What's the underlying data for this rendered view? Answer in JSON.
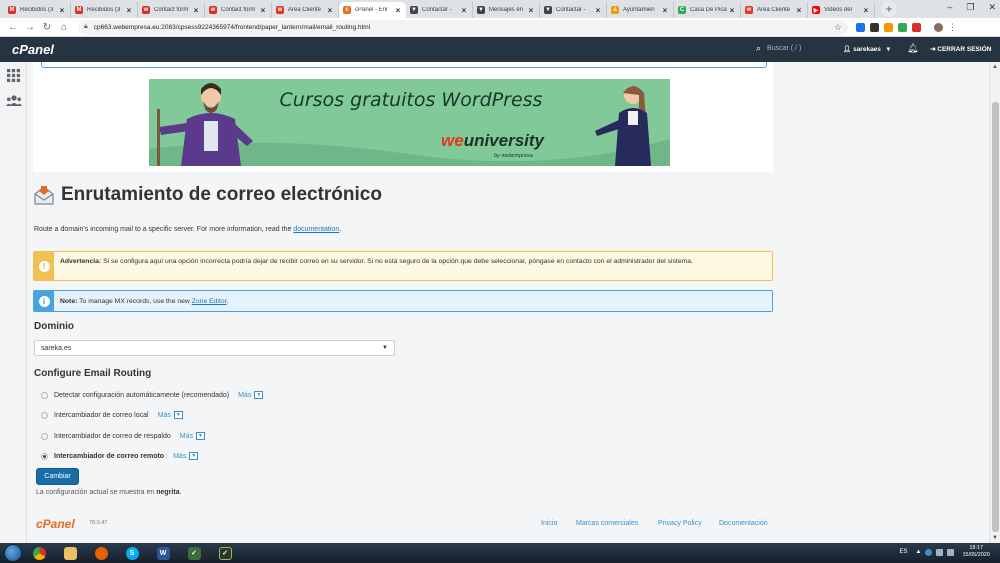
{
  "browser": {
    "tabs": [
      {
        "label": "Recibidos (3",
        "icon": "gmail-icon",
        "color": "#d93025",
        "glyph": "M"
      },
      {
        "label": "Recibidos (3",
        "icon": "gmail-icon",
        "color": "#d93025",
        "glyph": "M"
      },
      {
        "label": "Contact form",
        "icon": "site-icon",
        "color": "#d93025",
        "glyph": "w"
      },
      {
        "label": "Contact form",
        "icon": "site-icon",
        "color": "#d93025",
        "glyph": "w"
      },
      {
        "label": "Área Cliente",
        "icon": "webempresa-icon",
        "color": "#e2371f",
        "glyph": "w"
      },
      {
        "label": "cPanel - Enr",
        "icon": "cpanel-icon",
        "color": "#e46d24",
        "glyph": "c",
        "active": true
      },
      {
        "label": "Contactar -",
        "icon": "site-icon",
        "color": "#444444",
        "glyph": "▼"
      },
      {
        "label": "Mensajes en",
        "icon": "site-icon",
        "color": "#444444",
        "glyph": "▼"
      },
      {
        "label": "Contactar -",
        "icon": "site-icon",
        "color": "#444444",
        "glyph": "▼"
      },
      {
        "label": "Ayuntamien",
        "icon": "site-icon",
        "color": "#f29900",
        "glyph": "a"
      },
      {
        "label": "Casa De Pica",
        "icon": "site-icon",
        "color": "#34a853",
        "glyph": "C"
      },
      {
        "label": "Área Cliente",
        "icon": "webempresa-icon",
        "color": "#e2371f",
        "glyph": "w"
      },
      {
        "label": "Videos del",
        "icon": "youtube-icon",
        "color": "#ff0000",
        "glyph": "▶"
      }
    ],
    "url": "cp663.webempresa.eu:2083/cpsess9224365974/frontend/paper_lantern/mail/email_routing.html"
  },
  "header": {
    "logo": "cPanel",
    "search_placeholder": "Buscar ( / )",
    "user": "sarekaes",
    "logout": "CERRAR SESIÓN"
  },
  "banner": {
    "title": "Cursos gratuitos WordPress",
    "brand_we": "we",
    "brand_rest": "university",
    "brand_by": "by webempresa"
  },
  "page": {
    "title": "Enrutamiento de correo electrónico",
    "description": "Route a domain's incoming mail to a specific server. For more information, read the",
    "doc_link": "documentation",
    "warning_bold": "Advertencia:",
    "warning_text": "Si se configura aquí una opción incorrecta podría dejar de recibir correo en su servidor. Si no está seguro de la opción que debe seleccionar, póngase en contacto con el administrador del sistema.",
    "note_bold": "Note:",
    "note_text": "To manage MX records, use the new",
    "note_link": "Zone Editor",
    "domain_label": "Dominio",
    "domain_value": "sareka.es",
    "config_label": "Configure Email Routing",
    "options": [
      {
        "label": "Detectar configuración automáticamente (recomendado)",
        "more": "Más",
        "checked": false
      },
      {
        "label": "Intercambiador de correo local",
        "more": "Más",
        "checked": false
      },
      {
        "label": "Intercambiador de correo de respaldo",
        "more": "Más",
        "checked": false
      },
      {
        "label": "Intercambiador de correo remoto",
        "more": "Más",
        "checked": true
      }
    ],
    "change_button": "Cambiar",
    "current_config_prefix": "La configuración actual se muestra en",
    "current_config_bold": "negrita"
  },
  "footer": {
    "logo": "cPanel",
    "version": "78.0.47",
    "links": [
      "Inicio",
      "Marcas comerciales",
      "Privacy Policy",
      "Documentación"
    ]
  },
  "taskbar": {
    "lang": "ES",
    "time": "18:17",
    "date": "15/05/2020"
  },
  "colors": {
    "cpanel_header": "#263442",
    "banner_bg": "#82c99a",
    "accent_blue": "#1a6ca8",
    "warning_border": "#f0c150",
    "info_border": "#4aa3df",
    "cpanel_orange": "#e46d24"
  }
}
